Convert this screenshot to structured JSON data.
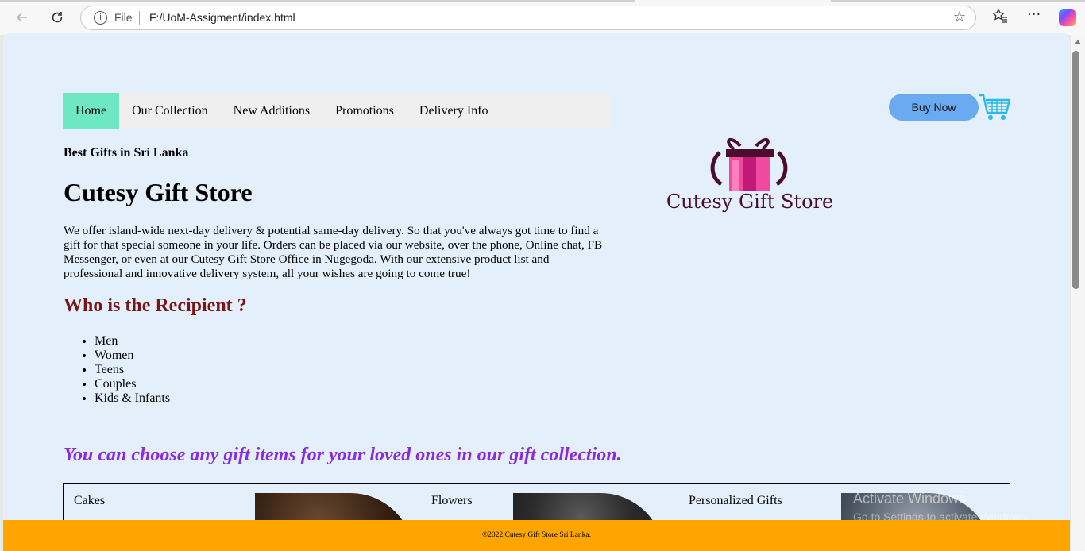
{
  "browser": {
    "address_prefix": "File",
    "url": "F:/UoM-Assigment/index.html",
    "icons": [
      "back-arrow-icon",
      "refresh-icon",
      "info-icon",
      "star-icon",
      "favorites-icon",
      "more-icon",
      "copilot-icon"
    ]
  },
  "nav": {
    "items": [
      {
        "label": "Home",
        "active": true
      },
      {
        "label": "Our Collection"
      },
      {
        "label": "New Additions"
      },
      {
        "label": "Promotions"
      },
      {
        "label": "Delivery Info"
      }
    ]
  },
  "buy_now": "Buy Now",
  "logo": {
    "text": "Cutesy Gift Store"
  },
  "tagline": "Best Gifts in Sri Lanka",
  "title": "Cutesy Gift Store",
  "intro": "We offer island-wide next-day delivery & potential same-day delivery. So that you've always got time to find a gift for that special someone in your life. Orders can be placed via our website, over the phone, Online chat, FB Messenger, or even at our Cutesy Gift Store Office in Nugegoda. With our extensive product list and professional and innovative delivery system, all your wishes are going to come true!",
  "recipient": {
    "heading": "Who is the Recipient ?",
    "items": [
      "Men",
      "Women",
      "Teens",
      "Couples",
      "Kids & Infants"
    ]
  },
  "choose_text": "You can choose any gift items for your loved ones in our gift collection.",
  "collection": {
    "categories": [
      "Cakes",
      "Flowers",
      "Personalized Gifts"
    ]
  },
  "watermark": {
    "line1": "Activate Windows",
    "line2": "Go to Settings to activate Windows."
  },
  "footer": "©2022.Cutesy Gift Store Sri Lanka.",
  "colors": {
    "page_bg": "#e3f0fc",
    "nav_active": "#6ee8c2",
    "buy_button": "#6aaaf0",
    "recipient_heading": "#7a1515",
    "choose_text": "#8a2be2",
    "footer_bg": "#ffa500"
  }
}
